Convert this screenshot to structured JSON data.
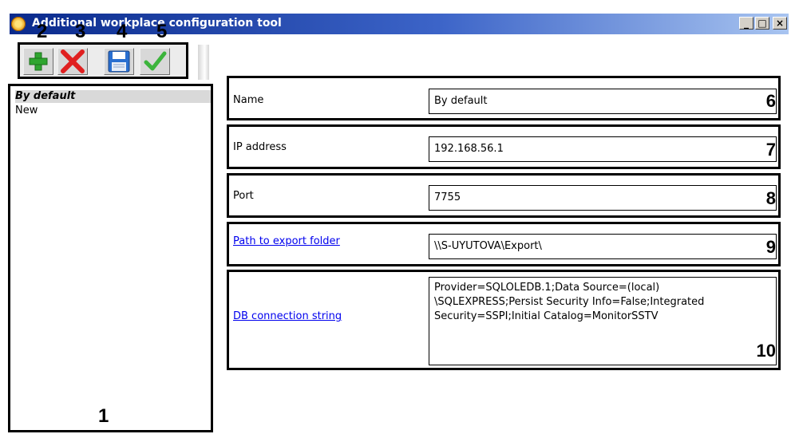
{
  "window": {
    "title": "Additional workplace configuration tool",
    "controls": {
      "minimize": "_",
      "maximize": "□",
      "close": "×"
    }
  },
  "toolbar": {
    "buttons": [
      {
        "name": "add",
        "icon": "plus-icon",
        "color": "#2fa52f"
      },
      {
        "name": "delete",
        "icon": "x-icon",
        "color": "#e02020"
      },
      {
        "name": "save",
        "icon": "floppy-disk-icon",
        "color": "#2a6fd0"
      },
      {
        "name": "apply",
        "icon": "check-icon",
        "color": "#3cb43c"
      }
    ]
  },
  "callouts": [
    "1",
    "2",
    "3",
    "4",
    "5",
    "6",
    "7",
    "8",
    "9",
    "10"
  ],
  "list": {
    "items": [
      {
        "label": "By default",
        "selected": true
      },
      {
        "label": "New",
        "selected": false
      }
    ]
  },
  "fields": {
    "name": {
      "label": "Name",
      "value": "By default"
    },
    "ip": {
      "label": "IP address",
      "value": "192.168.56.1"
    },
    "port": {
      "label": "Port",
      "value": "7755"
    },
    "export": {
      "label": "Path to export folder",
      "value": "\\\\S-UYUTOVA\\Export\\"
    },
    "db": {
      "label": "DB connection string",
      "value": "Provider=SQLOLEDB.1;Data Source=(local)\n\\SQLEXPRESS;Persist Security Info=False;Integrated\nSecurity=SSPI;Initial Catalog=MonitorSSTV"
    }
  },
  "colors": {
    "titlebar_start": "#0a2a8c",
    "link": "#0000ee",
    "selection": "#d9d9d9"
  }
}
